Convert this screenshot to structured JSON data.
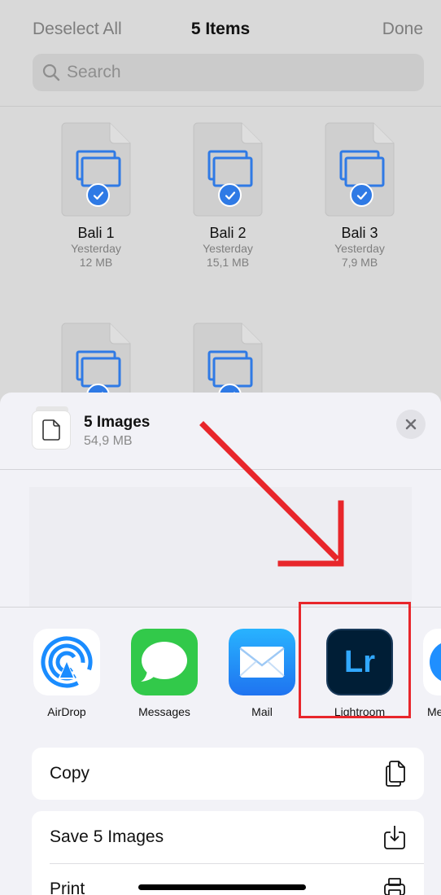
{
  "nav": {
    "left": "Deselect All",
    "title": "5 Items",
    "right": "Done"
  },
  "search": {
    "placeholder": "Search",
    "icon": "magnifying-glass"
  },
  "files": [
    {
      "name": "Bali 1",
      "date": "Yesterday",
      "size": "12 MB",
      "selected": true
    },
    {
      "name": "Bali 2",
      "date": "Yesterday",
      "size": "15,1 MB",
      "selected": true
    },
    {
      "name": "Bali 3",
      "date": "Yesterday",
      "size": "7,9 MB",
      "selected": true
    },
    {
      "name": "",
      "date": "",
      "size": "",
      "selected": true
    },
    {
      "name": "",
      "date": "",
      "size": "",
      "selected": true
    }
  ],
  "share_sheet": {
    "title": "5 Images",
    "subtitle": "54,9 MB",
    "apps": [
      {
        "label": "AirDrop",
        "icon": "airdrop-icon"
      },
      {
        "label": "Messages",
        "icon": "messages-icon"
      },
      {
        "label": "Mail",
        "icon": "mail-icon"
      },
      {
        "label": "Lightroom",
        "icon": "lightroom-icon",
        "icon_text": "Lr"
      },
      {
        "label": "Me",
        "icon": "partial-app-icon"
      }
    ],
    "actions_group1": [
      {
        "label": "Copy",
        "icon": "copy-icon"
      }
    ],
    "actions_group2": [
      {
        "label": "Save 5 Images",
        "icon": "save-to-photos-icon"
      },
      {
        "label": "Print",
        "icon": "print-icon"
      }
    ]
  },
  "colors": {
    "accent": "#2f7ae5",
    "annotation": "#e8262b",
    "lightroom_bg": "#001e36",
    "lightroom_text": "#31a8ff"
  }
}
